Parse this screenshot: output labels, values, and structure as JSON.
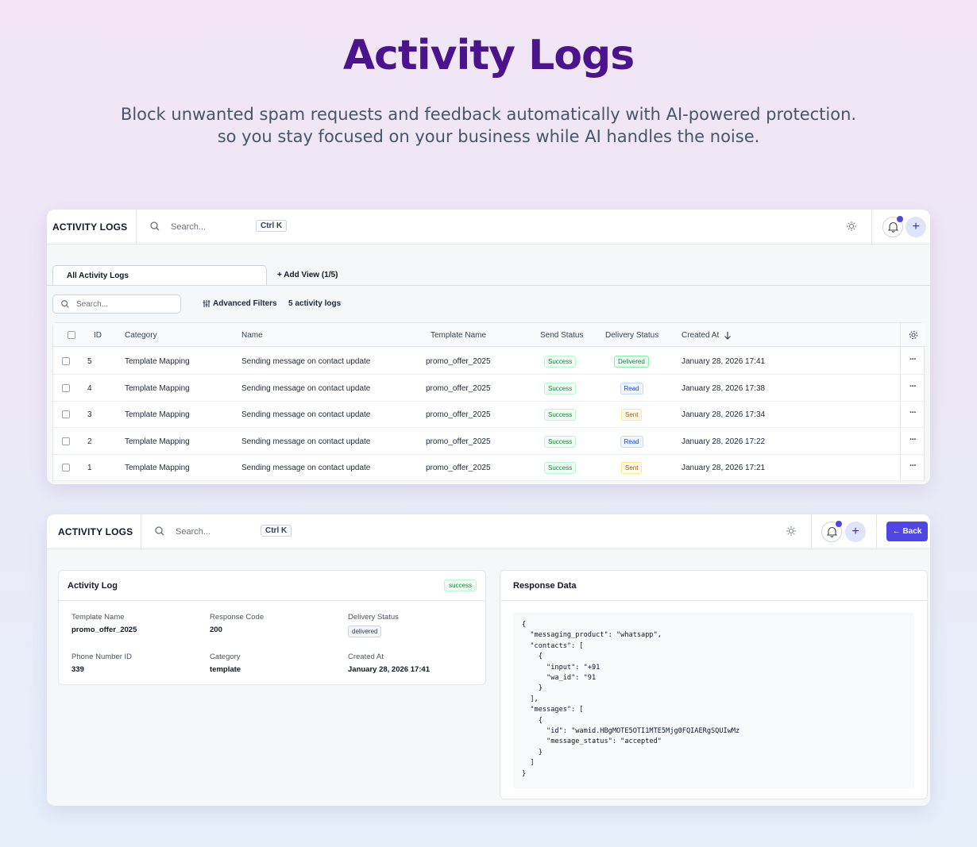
{
  "hero": {
    "title": "Activity Logs",
    "subtitle_line1": "Block unwanted spam requests and feedback automatically with AI-powered protection.",
    "subtitle_line2": "so you stay focused on your business while AI handles the noise."
  },
  "topbar": {
    "brand": "ACTIVITY LOGS",
    "search_placeholder": "Search...",
    "shortcut": "Ctrl K",
    "back_label": "Back",
    "icons": [
      "search-icon",
      "sun-icon",
      "bell-icon",
      "plus-icon",
      "arrow-left-icon"
    ]
  },
  "list": {
    "active_tab": "All Activity Logs",
    "add_view": "+ Add View (1/5)",
    "search_placeholder": "Search...",
    "advanced_filters": "Advanced Filters",
    "count_label": "5 activity logs",
    "columns": [
      "ID",
      "Category",
      "Name",
      "Template Name",
      "Send Status",
      "Delivery Status",
      "Created At"
    ],
    "rows": [
      {
        "id": "5",
        "category": "Template Mapping",
        "name": "Sending message on contact update",
        "template": "promo_offer_2025",
        "send": "Success",
        "delivery": "Delivered",
        "delivery_kind": "delivered",
        "created": "January 28, 2026 17:41"
      },
      {
        "id": "4",
        "category": "Template Mapping",
        "name": "Sending message on contact update",
        "template": "promo_offer_2025",
        "send": "Success",
        "delivery": "Read",
        "delivery_kind": "read",
        "created": "January 28, 2026 17:38"
      },
      {
        "id": "3",
        "category": "Template Mapping",
        "name": "Sending message on contact update",
        "template": "promo_offer_2025",
        "send": "Success",
        "delivery": "Sent",
        "delivery_kind": "sent",
        "created": "January 28, 2026 17:34"
      },
      {
        "id": "2",
        "category": "Template Mapping",
        "name": "Sending message on contact update",
        "template": "promo_offer_2025",
        "send": "Success",
        "delivery": "Read",
        "delivery_kind": "read",
        "created": "January 28, 2026 17:22"
      },
      {
        "id": "1",
        "category": "Template Mapping",
        "name": "Sending message on contact update",
        "template": "promo_offer_2025",
        "send": "Success",
        "delivery": "Sent",
        "delivery_kind": "sent",
        "created": "January 28, 2026 17:21"
      }
    ],
    "row_actions": "···"
  },
  "detail": {
    "log_title": "Activity Log",
    "status": "success",
    "template_name_label": "Template Name",
    "template_name_value": "promo_offer_2025",
    "response_code_label": "Response Code",
    "response_code_value": "200",
    "delivery_status_label": "Delivery Status",
    "delivery_status_value": "delivered",
    "phone_id_label": "Phone Number ID",
    "phone_id_value": "339",
    "category_label": "Category",
    "category_value": "template",
    "created_label": "Created At",
    "created_value": "January 28, 2026 17:41",
    "response_title": "Response Data",
    "response_json": "{\n  \"messaging_product\": \"whatsapp\",\n  \"contacts\": [\n    {\n      \"input\": \"+91\n      \"wa_id\": \"91\n    }\n  ],\n  \"messages\": [\n    {\n      \"id\": \"wamid.HBgMOTE5OTI1MTE5Mjg0FQIAERgSQUIwMz\n      \"message_status\": \"accepted\"\n    }\n  ]\n}"
  },
  "colors": {
    "accent": "#4f46e5",
    "title": "#4a148c"
  }
}
